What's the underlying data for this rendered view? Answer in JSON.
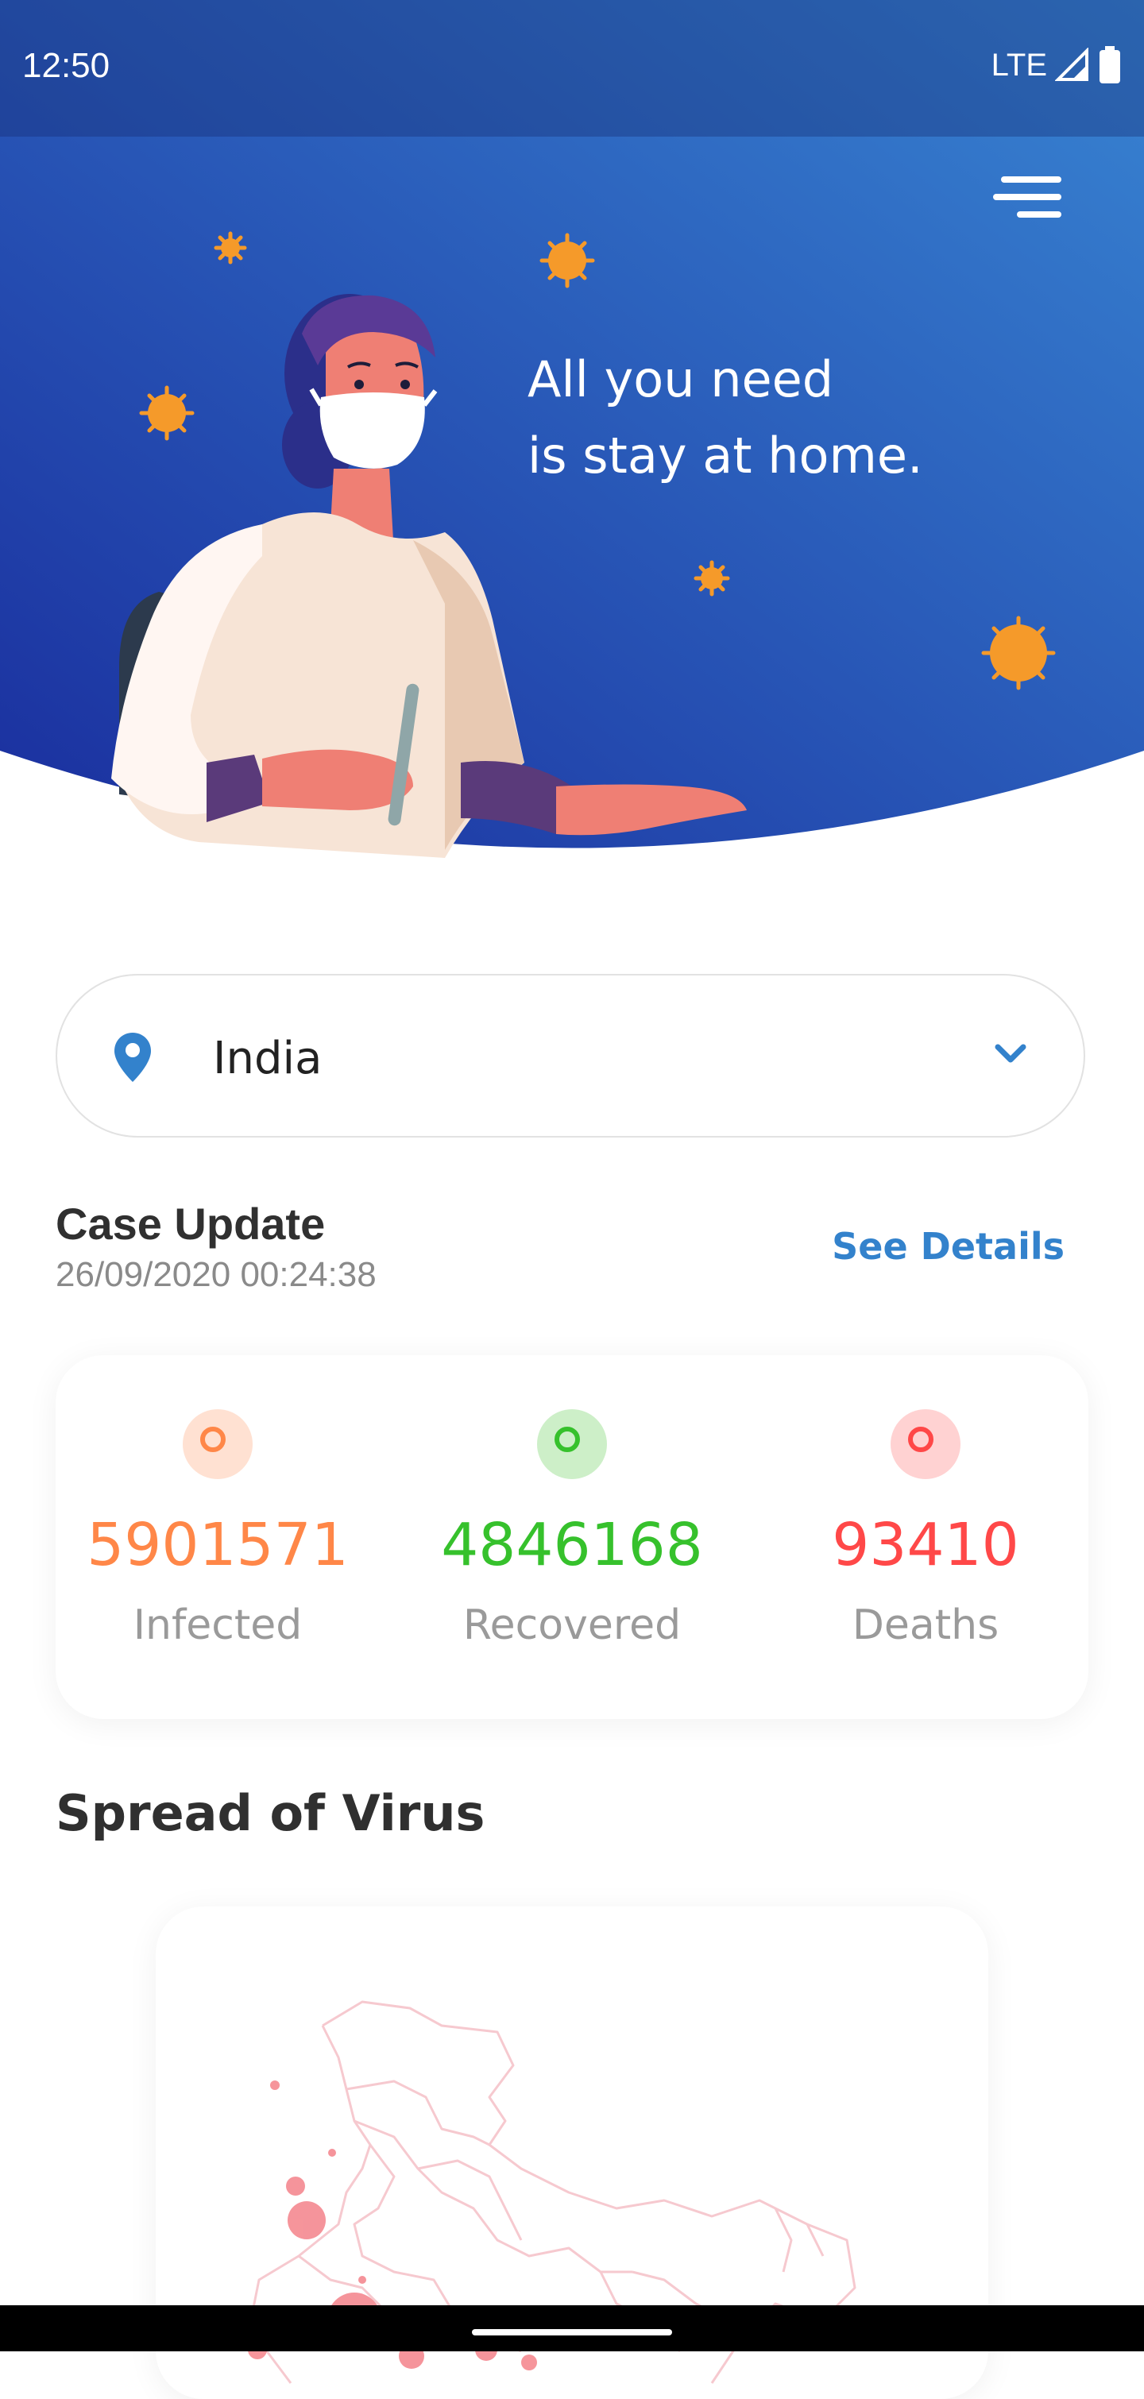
{
  "status_bar": {
    "time": "12:50",
    "network": "LTE"
  },
  "hero": {
    "headline_line1": "All you need",
    "headline_line2": "is stay at home.",
    "menu_icon": "hamburger-icon",
    "colors": {
      "gradient_start": "#1e3aa8",
      "gradient_end": "#3580d1",
      "virus": "#f59a2a"
    }
  },
  "country_selector": {
    "selected": "India",
    "icon": "location-pin-icon",
    "chevron": "chevron-down-icon"
  },
  "case_update": {
    "title": "Case Update",
    "timestamp": "26/09/2020 00:24:38",
    "see_details_label": "See Details"
  },
  "stats": [
    {
      "value": "5901571",
      "label": "Infected",
      "color": "#ff8748",
      "bg": "#ffe1d2"
    },
    {
      "value": "4846168",
      "label": "Recovered",
      "color": "#36c12c",
      "bg": "#cdefc8"
    },
    {
      "value": "93410",
      "label": "Deaths",
      "color": "#ff4848",
      "bg": "#ffd2d2"
    }
  ],
  "spread": {
    "title": "Spread of Virus"
  }
}
